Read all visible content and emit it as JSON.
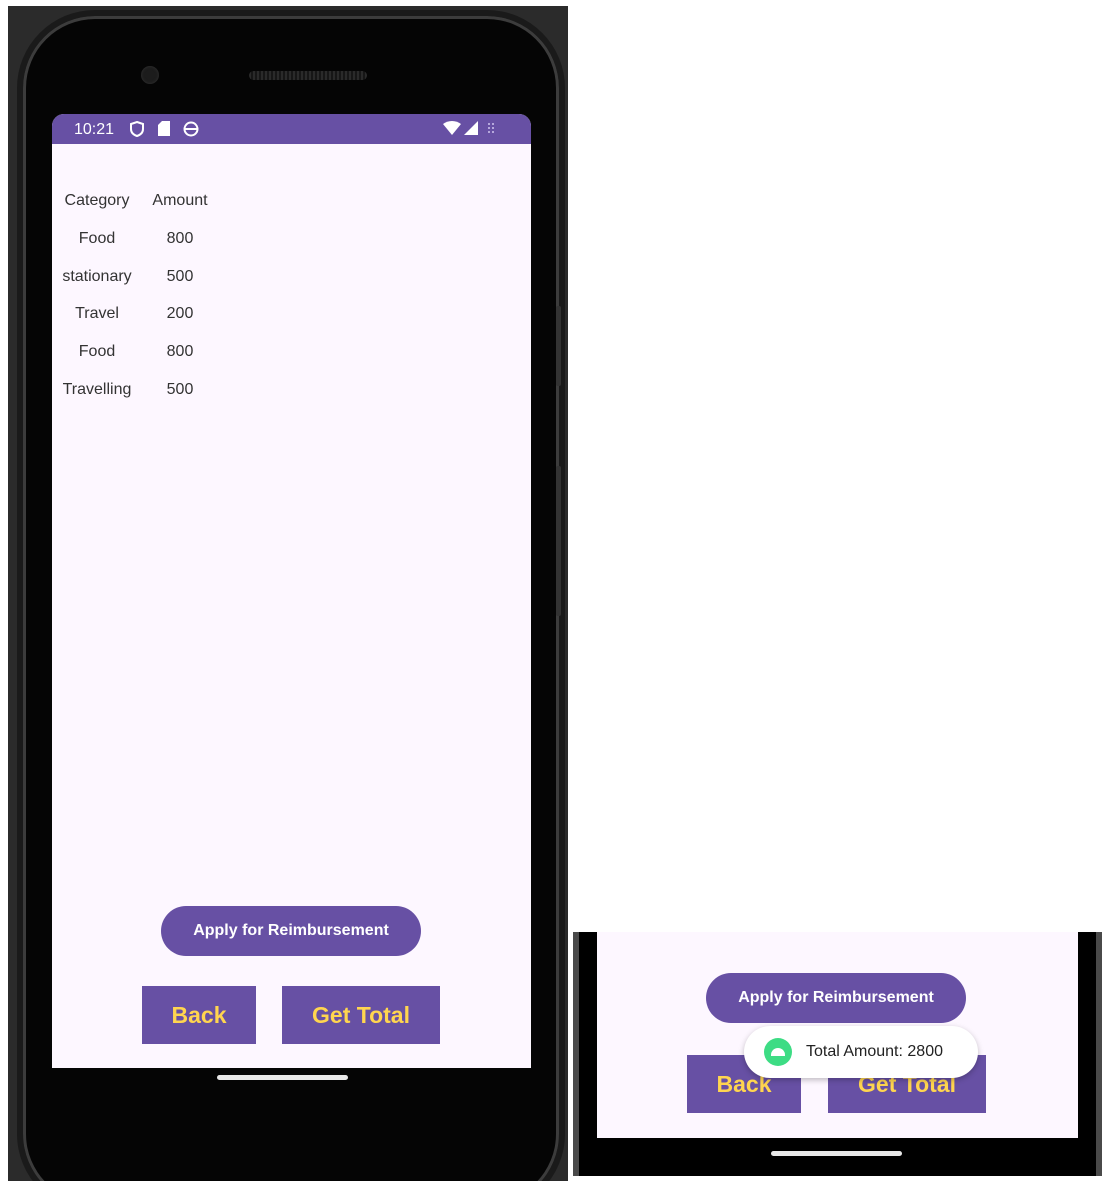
{
  "status_bar": {
    "time": "10:21",
    "icons": [
      "shield-icon",
      "sd-card-icon",
      "sync-icon",
      "wifi-icon",
      "signal-icon",
      "dots-icon"
    ]
  },
  "table": {
    "headers": {
      "category": "Category",
      "amount": "Amount"
    },
    "rows": [
      {
        "category": "Food",
        "amount": "800"
      },
      {
        "category": "stationary",
        "amount": "500"
      },
      {
        "category": "Travel",
        "amount": "200"
      },
      {
        "category": "Food",
        "amount": "800"
      },
      {
        "category": "Travelling",
        "amount": "500"
      }
    ]
  },
  "buttons": {
    "apply": "Apply for Reimbursement",
    "back": "Back",
    "get_total": "Get Total"
  },
  "toast": {
    "text": "Total Amount: 2800",
    "icon": "android-icon"
  },
  "colors": {
    "primary": "#6750a4",
    "button_text": "#ffd54f",
    "background": "#fdf7ff"
  }
}
